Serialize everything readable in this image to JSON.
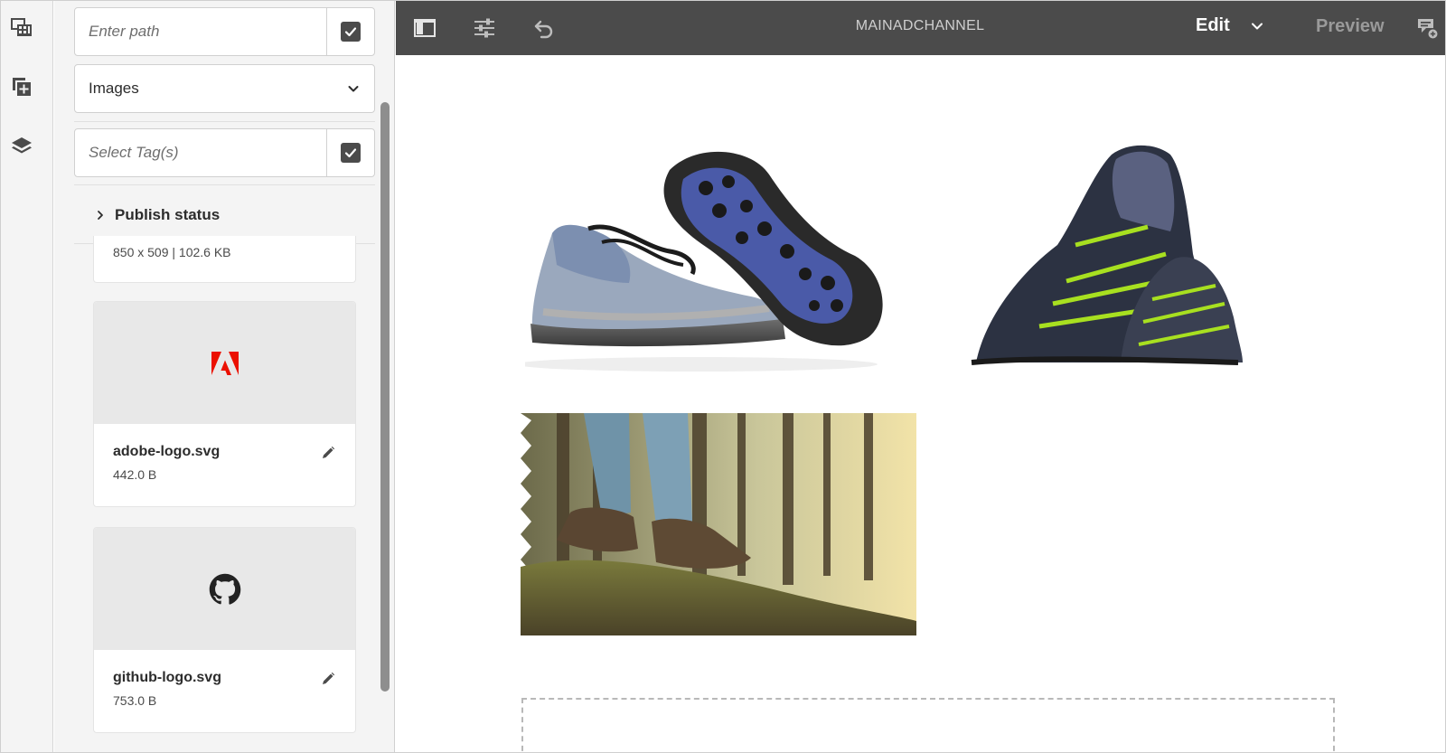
{
  "rail": {
    "items": [
      "assets-icon",
      "components-icon",
      "layers-icon"
    ]
  },
  "panel": {
    "path_placeholder": "Enter path",
    "asset_type": "Images",
    "tags_placeholder": "Select Tag(s)",
    "publish_status_label": "Publish status",
    "partial_asset_meta": "850 x 509 | 102.6 KB",
    "assets": [
      {
        "name": "adobe-logo.svg",
        "size": "442.0 B"
      },
      {
        "name": "github-logo.svg",
        "size": "753.0 B"
      }
    ]
  },
  "topbar": {
    "title": "MAINADCHANNEL",
    "mode": "Edit",
    "preview_label": "Preview"
  },
  "colors": {
    "topbar_bg": "#4b4b4b",
    "panel_bg": "#f4f4f4",
    "adobe_red": "#eb1000"
  }
}
